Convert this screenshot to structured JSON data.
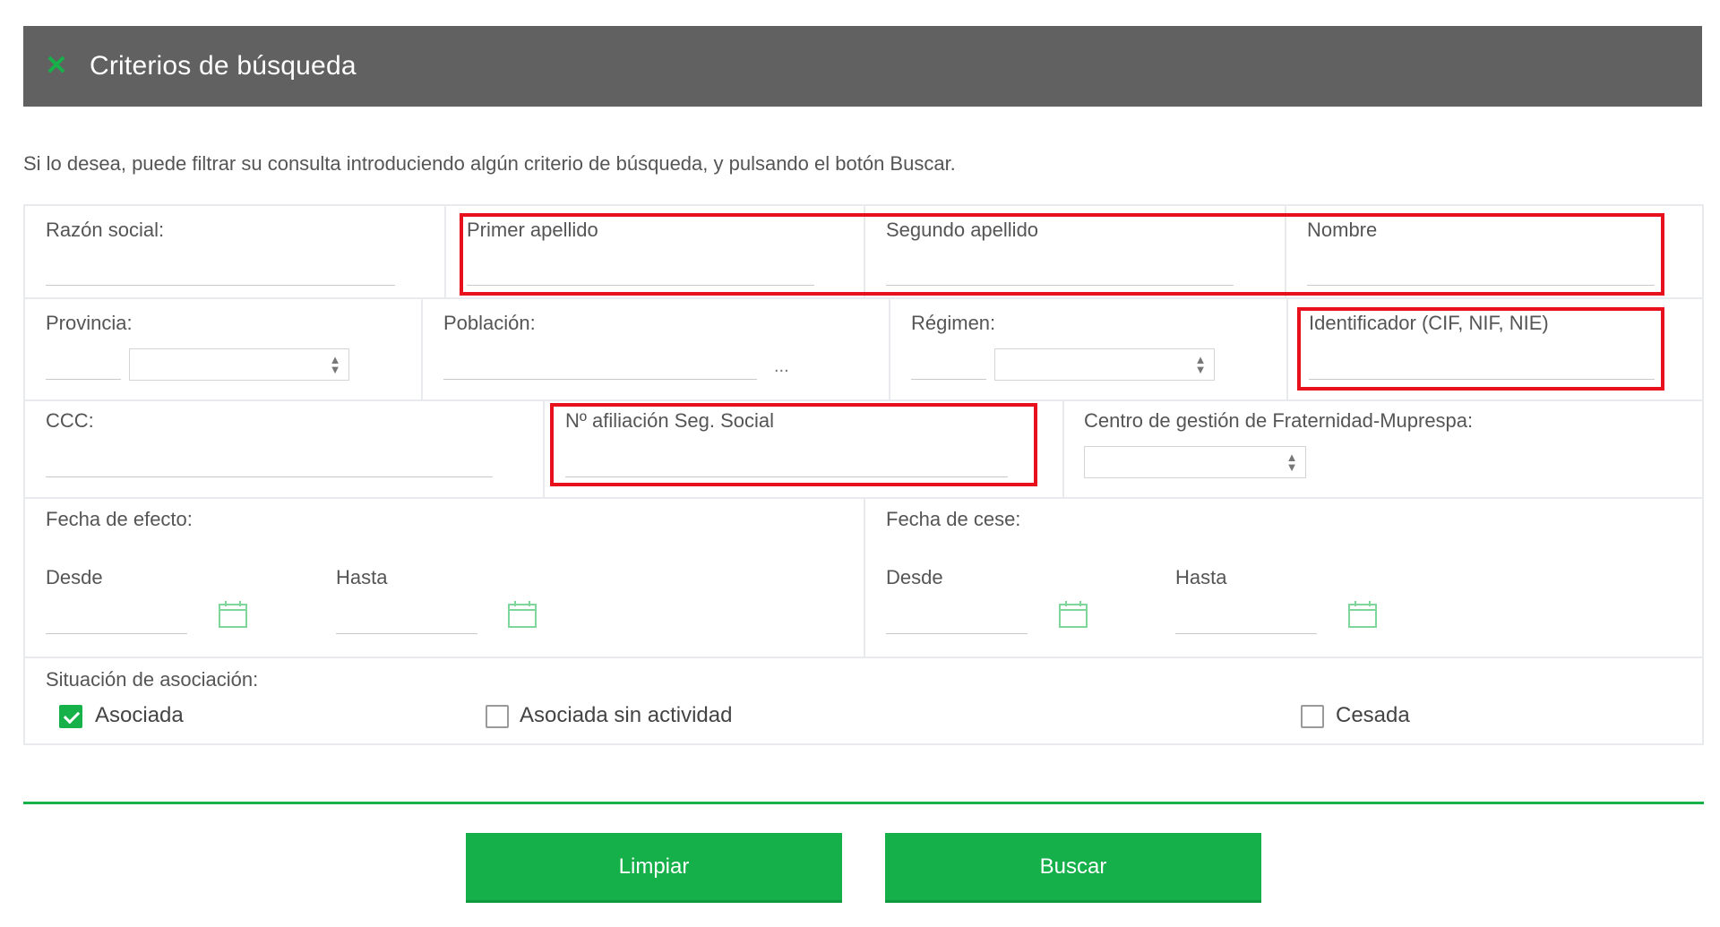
{
  "header": {
    "title": "Criterios de búsqueda",
    "icon": "close-icon",
    "icon_color": "#17b14a",
    "bg_color": "#616161"
  },
  "intro": "Si lo desea, puede filtrar su consulta introduciendo algún criterio de búsqueda, y pulsando el botón Buscar.",
  "fields": {
    "razon_social": "Razón social:",
    "primer_apellido": "Primer apellido",
    "segundo_apellido": "Segundo apellido",
    "nombre": "Nombre",
    "provincia": "Provincia:",
    "poblacion": "Población:",
    "poblacion_more": "...",
    "regimen": "Régimen:",
    "identificador": "Identificador (CIF, NIF, NIE)",
    "ccc": "CCC:",
    "afiliacion": "Nº afiliación Seg. Social",
    "centro_gestion": "Centro de gestión de Fraternidad-Muprespa:",
    "fecha_efecto": "Fecha de efecto:",
    "fecha_cese": "Fecha de cese:",
    "desde": "Desde",
    "hasta": "Hasta"
  },
  "situacion": {
    "label": "Situación de asociación:",
    "options": [
      {
        "label": "Asociada",
        "checked": true
      },
      {
        "label": "Asociada sin actividad",
        "checked": false
      },
      {
        "label": "Cesada",
        "checked": false
      }
    ]
  },
  "buttons": {
    "clear": "Limpiar",
    "search": "Buscar"
  },
  "colors": {
    "accent": "#17b14a",
    "highlight": "#e8101c"
  }
}
